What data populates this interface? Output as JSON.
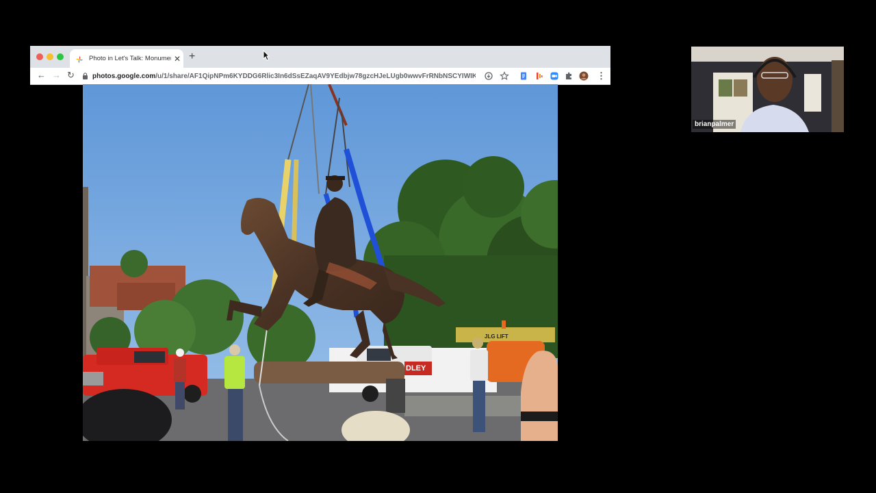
{
  "browser": {
    "tab_title": "Photo in Let's Talk: Monument",
    "url_domain": "photos.google.com",
    "url_path": "/u/1/share/AF1QipNPm6KYDDG6Rlic3In6dSsEZaqAV9YEdbjw78gzcHJeLUgb0wwvFrRNbNSCYIWIK..."
  },
  "participant": {
    "name": "brianpalmer"
  },
  "photo": {
    "sign_text": "JLG LIFT",
    "truck_text": "DLEY"
  },
  "colors": {
    "sky": "#6aa0dc",
    "red_truck": "#d42a22",
    "green_shirt": "#b6e640",
    "lift_orange": "#e46a22",
    "strap_blue": "#2050d8",
    "strap_yellow": "#e9d26a"
  }
}
